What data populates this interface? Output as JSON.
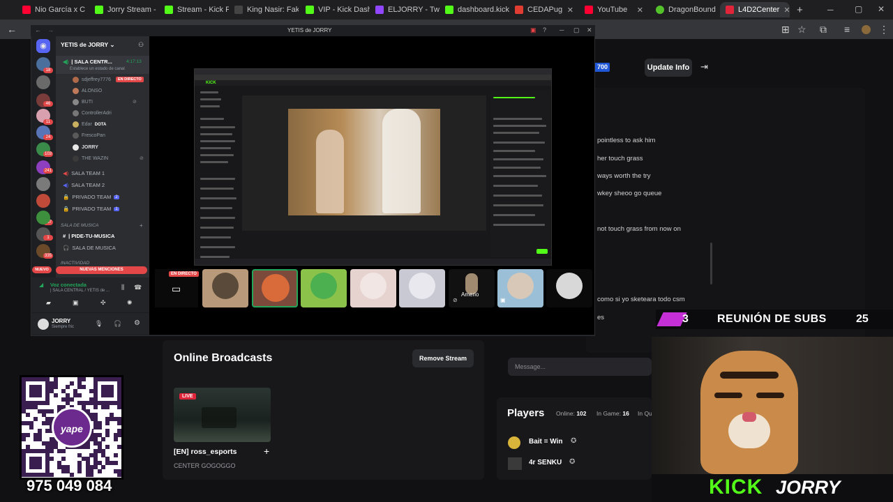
{
  "browser": {
    "tabs": [
      {
        "label": "Nio García x C",
        "color": "#ff0033"
      },
      {
        "label": "Jorry Stream -",
        "color": "#53fc18"
      },
      {
        "label": "Stream - Kick F",
        "color": "#53fc18"
      },
      {
        "label": "King Nasir: Fak",
        "color": "#111111"
      },
      {
        "label": "VIP - Kick Dash",
        "color": "#53fc18"
      },
      {
        "label": "ELJORRY - Twit",
        "color": "#9146ff"
      },
      {
        "label": "dashboard.kick",
        "color": "#53fc18"
      },
      {
        "label": "CEDAPug",
        "color": "#e03c31"
      },
      {
        "label": "YouTube",
        "color": "#ff0033"
      },
      {
        "label": "DragonBound",
        "color": "#53c22b"
      },
      {
        "label": "L4D2Center",
        "color": "#e0243a"
      }
    ],
    "new_tab": "+"
  },
  "discord": {
    "window_title": "YETIS de JORRY",
    "server_name": "YETIS de JORRY",
    "guild_badges": [
      "18",
      "46",
      "11",
      "24",
      "103",
      "241",
      "167",
      "1",
      "335"
    ],
    "voice_channel": {
      "name": "| SALA CENTR...",
      "timer": "4:17:13",
      "status": "Establece un estado de canal"
    },
    "live_badge": "EN DIRECTO",
    "voice_users": [
      {
        "name": "sdjeffrey7776"
      },
      {
        "name": "ALONSO"
      },
      {
        "name": "BUTI"
      },
      {
        "name": "ControllerAdri"
      },
      {
        "name": "Edar",
        "game": "DOTA"
      },
      {
        "name": "FrescoPan"
      },
      {
        "name": "JORRY"
      },
      {
        "name": "THE WAZIN"
      }
    ],
    "channels": [
      {
        "name": "SALA TEAM 1"
      },
      {
        "name": "SALA TEAM 2"
      },
      {
        "name": "PRIVADO TEAM",
        "count": "2"
      },
      {
        "name": "PRIVADO TEAM",
        "count": "1"
      }
    ],
    "category_music": "SALA DE MUSICA",
    "music_channels": [
      "| PIDE-TU-MUSICA",
      "SALA DE MUSICA"
    ],
    "category_inactive": "INACTIVIDAD",
    "new_label": "NUEVO",
    "new_mentions": "NUEVAS MENCIONES",
    "voice_connected": "Voz conectada",
    "voice_location": "| SALA CENTRAL / YETIS de ...",
    "user": {
      "name": "JORRY",
      "status": "Siempre fric"
    },
    "stage_live": "EN DIRECTO",
    "participant_label": "Amerio"
  },
  "dashboard": {
    "badge_number": "700",
    "update_info": "Update Info",
    "chat_lines": [
      "pointless to ask him",
      "her touch grass",
      "ways worth the try",
      "wkey sheoo go queue",
      "not touch grass from now on",
      "como si yo sketeara todo csm",
      "es"
    ],
    "message_placeholder": "Message...",
    "online_broadcasts": "Online Broadcasts",
    "remove_stream": "Remove Stream",
    "live": "LIVE",
    "broadcast_title": "[EN] ross_esports",
    "broadcast_sub": "CENTER GOGOGGO",
    "players_title": "Players",
    "online_label": "Online:",
    "online_count": "102",
    "ingame_label": "In Game:",
    "ingame_count": "16",
    "inqueue_label": "In Qu",
    "player_rows": [
      "Bait = Win",
      "4r SENKU"
    ]
  },
  "overlay": {
    "sub_count": "3",
    "sub_title": "REUNIÓN DE SUBS",
    "sub_goal": "25",
    "kick": "KICK",
    "jorry": "JORRY",
    "phone": "975 049 084",
    "yape": "yape"
  }
}
